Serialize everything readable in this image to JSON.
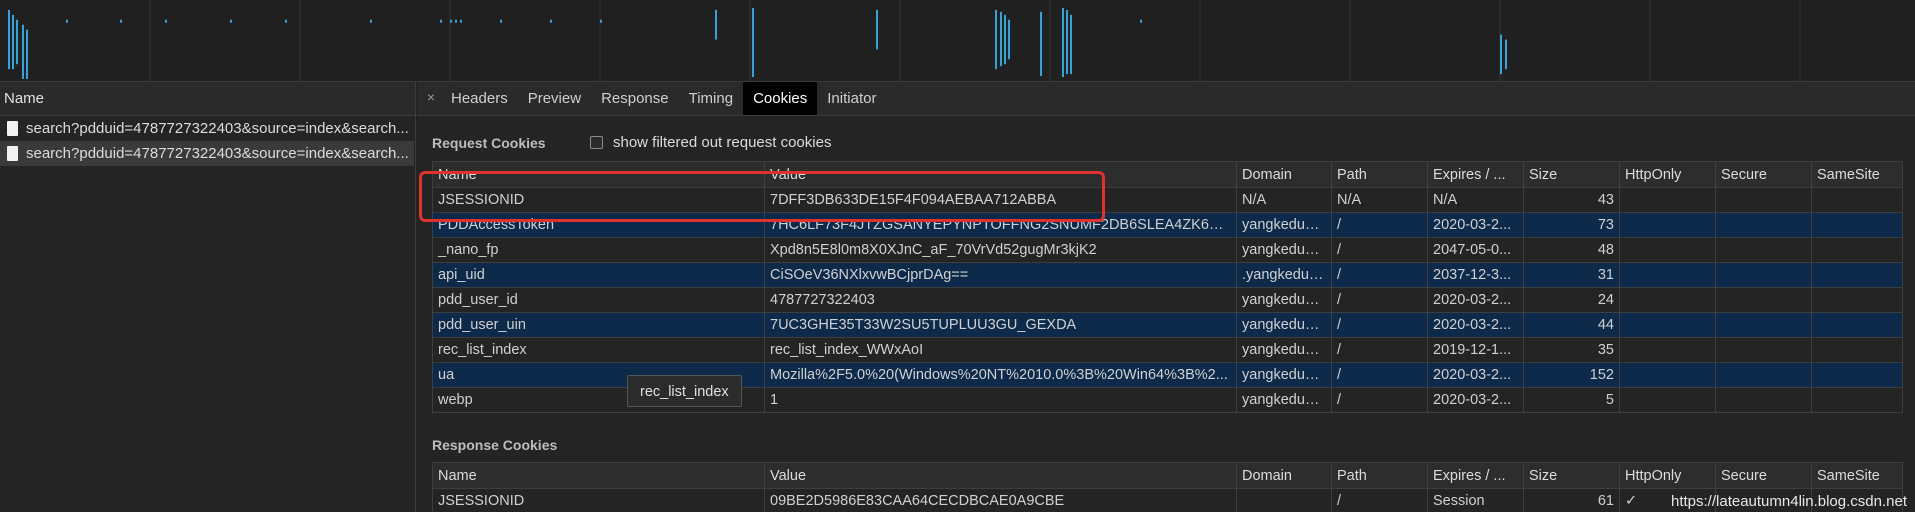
{
  "left_panel": {
    "header": "Name",
    "requests": [
      {
        "name": "search?pdduid=4787727322403&source=index&search..."
      },
      {
        "name": "search?pdduid=4787727322403&source=index&search..."
      }
    ]
  },
  "tabs": {
    "close_glyph": "×",
    "items": [
      "Headers",
      "Preview",
      "Response",
      "Timing",
      "Cookies",
      "Initiator"
    ],
    "active": "Cookies"
  },
  "request_cookies": {
    "title": "Request Cookies",
    "filter_label": "show filtered out request cookies",
    "columns": [
      "Name",
      "Value",
      "Domain",
      "Path",
      "Expires / ...",
      "Size",
      "HttpOnly",
      "Secure",
      "SameSite"
    ],
    "rows": [
      [
        "JSESSIONID",
        "7DFF3DB633DE15F4F094AEBAA712ABBA",
        "N/A",
        "N/A",
        "N/A",
        "43",
        "",
        "",
        ""
      ],
      [
        "PDDAccessToken",
        "7HC6LF73F4JTZGSANYEPYNPTOFFNG2SNUMF2DB6SLEA4ZK6PHE...",
        "yangkeduo....",
        "/",
        "2020-03-2...",
        "73",
        "",
        "",
        ""
      ],
      [
        "_nano_fp",
        "Xpd8n5E8l0m8X0XJnC_aF_70VrVd52gugMr3kjK2",
        "yangkeduo....",
        "/",
        "2047-05-0...",
        "48",
        "",
        "",
        ""
      ],
      [
        "api_uid",
        "CiSOeV36NXlxvwBCjprDAg==",
        ".yangkeduo...",
        "/",
        "2037-12-3...",
        "31",
        "",
        "",
        ""
      ],
      [
        "pdd_user_id",
        "4787727322403",
        "yangkeduo....",
        "/",
        "2020-03-2...",
        "24",
        "",
        "",
        ""
      ],
      [
        "pdd_user_uin",
        "7UC3GHE35T33W2SU5TUPLUU3GU_GEXDA",
        "yangkeduo....",
        "/",
        "2020-03-2...",
        "44",
        "",
        "",
        ""
      ],
      [
        "rec_list_index",
        "rec_list_index_WWxAoI",
        "yangkeduo....",
        "/",
        "2019-12-1...",
        "35",
        "",
        "",
        ""
      ],
      [
        "ua",
        "Mozilla%2F5.0%20(Windows%20NT%2010.0%3B%20Win64%3B%2...",
        "yangkeduo....",
        "/",
        "2020-03-2...",
        "152",
        "",
        "",
        ""
      ],
      [
        "webp",
        "1",
        "yangkeduo....",
        "/",
        "2020-03-2...",
        "5",
        "",
        "",
        ""
      ]
    ]
  },
  "response_cookies": {
    "title": "Response Cookies",
    "columns": [
      "Name",
      "Value",
      "Domain",
      "Path",
      "Expires / ...",
      "Size",
      "HttpOnly",
      "Secure",
      "SameSite"
    ],
    "rows": [
      [
        "JSESSIONID",
        "09BE2D5986E83CAA64CECDBCAE0A9CBE",
        "",
        "/",
        "Session",
        "61",
        "✓",
        "",
        ""
      ]
    ]
  },
  "tooltip": "rec_list_index",
  "watermark": "https://lateautumn4lin.blog.csdn.net",
  "colors": {
    "background": "#242424",
    "selected_row": "#0d2a4a",
    "highlight": "#e0322d",
    "timeline_bar": "#3aa0d8"
  }
}
